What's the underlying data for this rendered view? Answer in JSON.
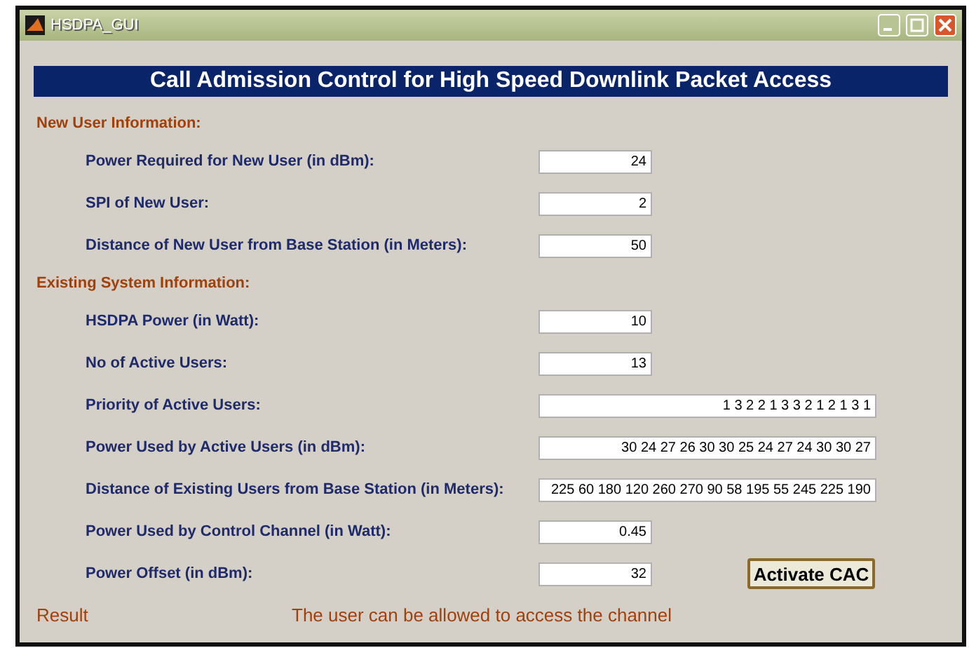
{
  "window": {
    "title": "HSDPA_GUI"
  },
  "heading": "Call Admission Control for High Speed Downlink Packet Access",
  "items": [
    {
      "kind": "section",
      "label": "New User Information:"
    },
    {
      "kind": "short",
      "label": "Power Required for New User (in dBm):",
      "value": "24"
    },
    {
      "kind": "short",
      "label": "SPI of New User:",
      "value": "2"
    },
    {
      "kind": "short",
      "label": "Distance of New User from Base Station (in Meters):",
      "value": "50"
    },
    {
      "kind": "section",
      "label": "Existing System Information:"
    },
    {
      "kind": "short",
      "label": "HSDPA Power (in Watt):",
      "value": "10"
    },
    {
      "kind": "short",
      "label": "No of Active Users:",
      "value": "13"
    },
    {
      "kind": "long",
      "label": "Priority of Active Users:",
      "value": "1 3 2 2 1 3 3 2 1 2 1 3 1"
    },
    {
      "kind": "long",
      "label": "Power Used by Active Users (in dBm):",
      "value": "30 24 27 26 30 30 25 24 27 24 30 30 27"
    },
    {
      "kind": "long",
      "label": "Distance of Existing Users from Base Station (in Meters):",
      "value": "225 60 180 120 260 270 90 58 195 55 245 225 190"
    },
    {
      "kind": "short",
      "label": "Power Used by Control Channel (in Watt):",
      "value": "0.45"
    },
    {
      "kind": "short",
      "label": "Power Offset (in dBm):",
      "value": "32"
    }
  ],
  "button": "Activate CAC",
  "result": {
    "label": "Result",
    "message": "The user can be allowed to access the channel"
  }
}
